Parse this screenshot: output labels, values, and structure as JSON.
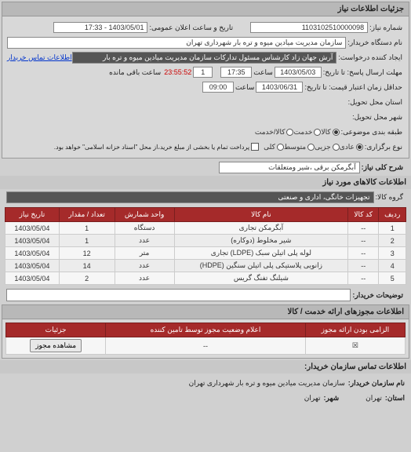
{
  "panel1": {
    "title": "جزئیات اطلاعات نیاز",
    "number_lbl": "شماره نیاز:",
    "number": "1103102510000098",
    "announce_lbl": "تاریخ و ساعت اعلان عمومی:",
    "announce": "1403/05/01 - 17:33",
    "buyer_name_lbl": "نام دستگاه خریدار:",
    "buyer_name": "سازمان مدیریت میادین میوه و تره بار شهرداری تهران",
    "requester_lbl": "ایجاد کننده درخواست:",
    "requester": "آرش جهان زاد کارشناس مسئول تدارکات سازمان مدیریت میادین میوه و تره بار",
    "contact_link": "اطلاعات تماس خریدار",
    "deadline_send_lbl": "مهلت ارسال پاسخ: تا تاریخ:",
    "deadline_date": "1403/05/03",
    "time_lbl": "ساعت",
    "deadline_time": "17:35",
    "qty_small": "1",
    "countdown": "23:55:52",
    "remain_lbl": "ساعت باقی مانده",
    "min_valid_lbl": "حداقل زمان اعتبار قیمت: تا تاریخ:",
    "min_valid_date": "1403/06/31",
    "min_valid_time": "09:00",
    "province_lbl": "استان محل تحویل:",
    "city_lbl": "شهر محل تحویل:",
    "cat_lbl": "طبقه بندی موضوعی:",
    "cat_goods": "کالا",
    "cat_service": "خدمت",
    "cat_goods_service": "کالا/خدمت",
    "process_lbl": "نوع برگزاری:",
    "process_notes": "پرداخت تمام یا بخشی از مبلغ خرید،از محل \"اسناد خزانه اسلامی\" خواهد بود.",
    "proc_opt1": "عادی",
    "proc_opt2": "جزیی",
    "proc_opt3": "متوسط",
    "proc_opt4": "کلی"
  },
  "need": {
    "desc_lbl": "شرح کلی نیاز:",
    "desc": "آبگرمکن برقی ،شیر ومتعلقات"
  },
  "goods": {
    "title": "اطلاعات کالاهای مورد نیاز",
    "group_lbl": "گروه کالا:",
    "group": "تجهیزات خانگی، اداری و صنعتی",
    "cols": [
      "ردیف",
      "کد کالا",
      "نام کالا",
      "واحد شمارش",
      "تعداد / مقدار",
      "تاریخ نیاز"
    ],
    "rows": [
      [
        "1",
        "--",
        "آبگرمکن تجاری",
        "دستگاه",
        "1",
        "1403/05/04"
      ],
      [
        "2",
        "--",
        "شیر مخلوط (دوکاره)",
        "عدد",
        "1",
        "1403/05/04"
      ],
      [
        "3",
        "--",
        "لوله پلی اتیلن سبک (LDPE) تجاری",
        "متر",
        "12",
        "1403/05/04"
      ],
      [
        "4",
        "--",
        "زانویی پلاستیکی پلی اتیلن سنگین (HDPE)",
        "عدد",
        "14",
        "1403/05/04"
      ],
      [
        "5",
        "--",
        "شیلنگ تفنگ گریس",
        "عدد",
        "2",
        "1403/05/04"
      ]
    ]
  },
  "buyer_desc_lbl": "توضیحات خریدار:",
  "license": {
    "title": "اطلاعات مجوزهای ارائه خدمت / کالا",
    "cols": [
      "الزامی بودن ارائه مجوز",
      "اعلام وضعیت مجوز توسط تامین کننده",
      "جزئیات"
    ],
    "mandatory_icon": "☒",
    "status": "--",
    "btn": "مشاهده مجوز"
  },
  "contact": {
    "title": "اطلاعات تماس سازمان خریدار:",
    "org_lbl": "نام سازمان خریدار:",
    "org": "سازمان مدیریت میادین میوه و تره بار شهرداری تهران",
    "prov_lbl": "استان:",
    "prov": "تهران",
    "city_lbl": "شهر:",
    "city": "تهران"
  }
}
